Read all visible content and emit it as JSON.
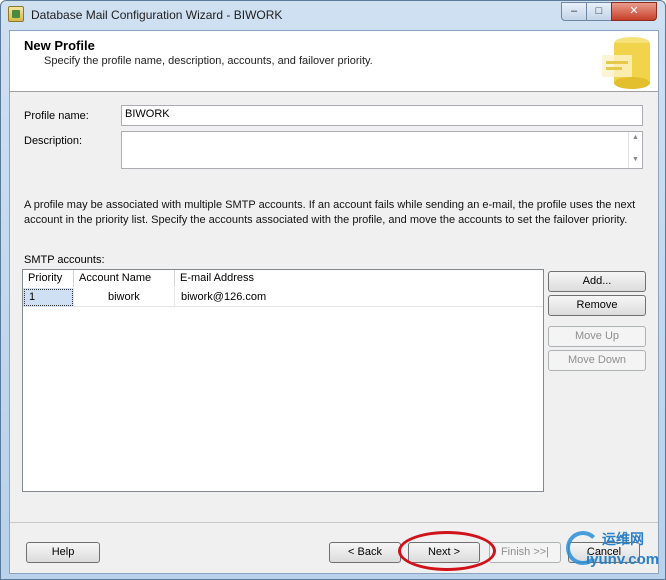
{
  "window": {
    "title": "Database Mail Configuration Wizard - BIWORK",
    "minimize_glyph": "–",
    "maximize_glyph": "□",
    "close_glyph": "✕"
  },
  "header": {
    "title": "New Profile",
    "subtitle": "Specify the profile name, description, accounts, and failover priority."
  },
  "form": {
    "profile_name_label": "Profile name:",
    "profile_name_value": "BIWORK",
    "description_label": "Description:",
    "description_value": ""
  },
  "info_text": "A profile may be associated with multiple SMTP accounts. If an account fails while sending an e-mail, the profile uses the next account in the priority list. Specify the accounts associated with the profile, and move the accounts to set the failover priority.",
  "smtp": {
    "label": "SMTP accounts:",
    "columns": [
      "Priority",
      "Account Name",
      "E-mail Address"
    ],
    "rows": [
      {
        "priority": "1",
        "account_name": "biwork",
        "email": "biwork@126.com"
      }
    ],
    "buttons": {
      "add": "Add...",
      "remove": "Remove",
      "move_up": "Move Up",
      "move_down": "Move Down"
    }
  },
  "footer": {
    "help": "Help",
    "back": "< Back",
    "next": "Next >",
    "finish": "Finish >>|",
    "cancel": "Cancel"
  },
  "watermark": {
    "chinese": "运维网",
    "url": "iyunv.com"
  },
  "colors": {
    "highlight_ring": "#d0121a",
    "watermark_blue": "#2a7fc9"
  }
}
